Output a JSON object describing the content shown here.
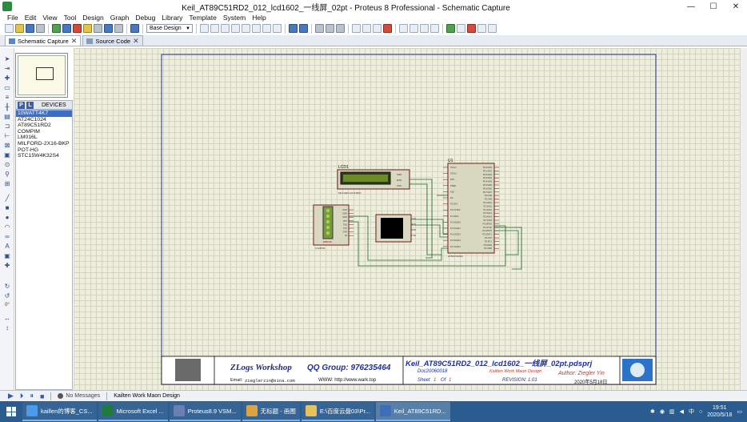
{
  "window": {
    "title": "Keil_AT89C51RD2_012_lcd1602_一线屏_02pt - Proteus 8 Professional - Schematic Capture",
    "minimize": "—",
    "maximize": "☐",
    "close": "✕"
  },
  "menu": [
    "File",
    "Edit",
    "View",
    "Tool",
    "Design",
    "Graph",
    "Debug",
    "Library",
    "Template",
    "System",
    "Help"
  ],
  "toolbar": {
    "design_select": "Base Design"
  },
  "tabs": [
    {
      "label": "Schematic Capture",
      "active": true
    },
    {
      "label": "Source Code",
      "active": false
    }
  ],
  "device_panel": {
    "p_button": "P",
    "l_button": "L",
    "header": "DEVICES",
    "items": [
      "10WATT4K7",
      "AT24C1024",
      "AT89C51RD2",
      "COMPIM",
      "LM016L",
      "MILFORD-2X16-BKP",
      "POT-HG",
      "STC15W4K32S4"
    ],
    "selected_index": 0
  },
  "left_strip": {
    "rotation": "0°"
  },
  "schematic": {
    "lcd_label": "LCD1",
    "lcd_part": "MILFORD-2X16-BKP",
    "lcd_pins": [
      "VDD",
      "RXD",
      "VSS"
    ],
    "mcu_label": "U1",
    "mcu_part": "AT89C51RD2",
    "mcu_left_pins": [
      "XTAL1",
      "XTAL2",
      "RST",
      "PSEN",
      "ALE",
      "EA",
      "P1.0/T2",
      "P1.1/T2EX",
      "P1.2/ECI",
      "P1.3/CEX0",
      "P1.4/CEX1",
      "P1.5/CEX2",
      "P1.6/CEX3",
      "P1.7/CEX4"
    ],
    "mcu_right_pins": [
      "P0.0/AD0",
      "P0.1/AD1",
      "P0.2/AD2",
      "P0.3/AD3",
      "P0.4/AD4",
      "P0.5/AD5",
      "P0.6/AD6",
      "P0.7/AD7",
      "P2.0/A8",
      "P2.1/A9",
      "P2.2/A10",
      "P2.3/A11",
      "P2.4/A12",
      "P2.5/A13",
      "P2.6/A14",
      "P2.7/A15",
      "P3.0/RXD",
      "P3.1/TXD",
      "P3.2/INT0",
      "P3.3/INT1",
      "P3.4/T0",
      "P3.5/T1",
      "P3.6/WR",
      "P3.7/RD"
    ],
    "terminal_pins": [
      "CTS",
      "RTS",
      "RXD",
      "TXD"
    ],
    "com_label": "COMPIM",
    "com_pins": [
      "DCD",
      "DSR",
      "RXD",
      "RTS",
      "TXD",
      "CTS",
      "DTR",
      "RI"
    ],
    "com_error": "ERROR"
  },
  "title_block": {
    "workshop": "ZLogs Workshop",
    "email_label": "Email:",
    "email": "zieglerzin@sina.com",
    "qq": "QQ Group: 976235464",
    "www": "WWW: http://www.wark.top",
    "project": "Keil_AT89C51RD2_012_lcd1602_一线屏_02pt.pdsprj",
    "doc": "Doc20060018",
    "company": "Kailten Work Maon Design",
    "sheet": "Sheet",
    "sheet_num": "1",
    "of": "Of",
    "of_num": "1",
    "revision": "REVISION: 1.01",
    "author": "Author:  Ziegler Yin",
    "date": "2020年5月18日"
  },
  "status": {
    "messages": "No Messages",
    "design": "Kailten Work Maon Design"
  },
  "taskbar": {
    "items": [
      {
        "label": "kaillen的博客_CS...",
        "color": "#4c9be8"
      },
      {
        "label": "Microsoft Excel ...",
        "color": "#1f7a3f"
      },
      {
        "label": "Proteus8.9 VSM...",
        "color": "#6b7fb0"
      },
      {
        "label": "无标题 - 画图",
        "color": "#d9a441"
      },
      {
        "label": "E:\\百度云盘03\\Pr...",
        "color": "#e6c15c"
      },
      {
        "label": "Keil_AT89C51RD...",
        "color": "#3d6fb6"
      }
    ],
    "ime": "中",
    "time": "19:51",
    "date": "2020/5/18"
  },
  "colors": {
    "canvas_bg": "#eeeedc",
    "border_blue": "#1f2f9f",
    "wire_green": "#1f6b2a",
    "component_fill": "#d9d9c2"
  }
}
